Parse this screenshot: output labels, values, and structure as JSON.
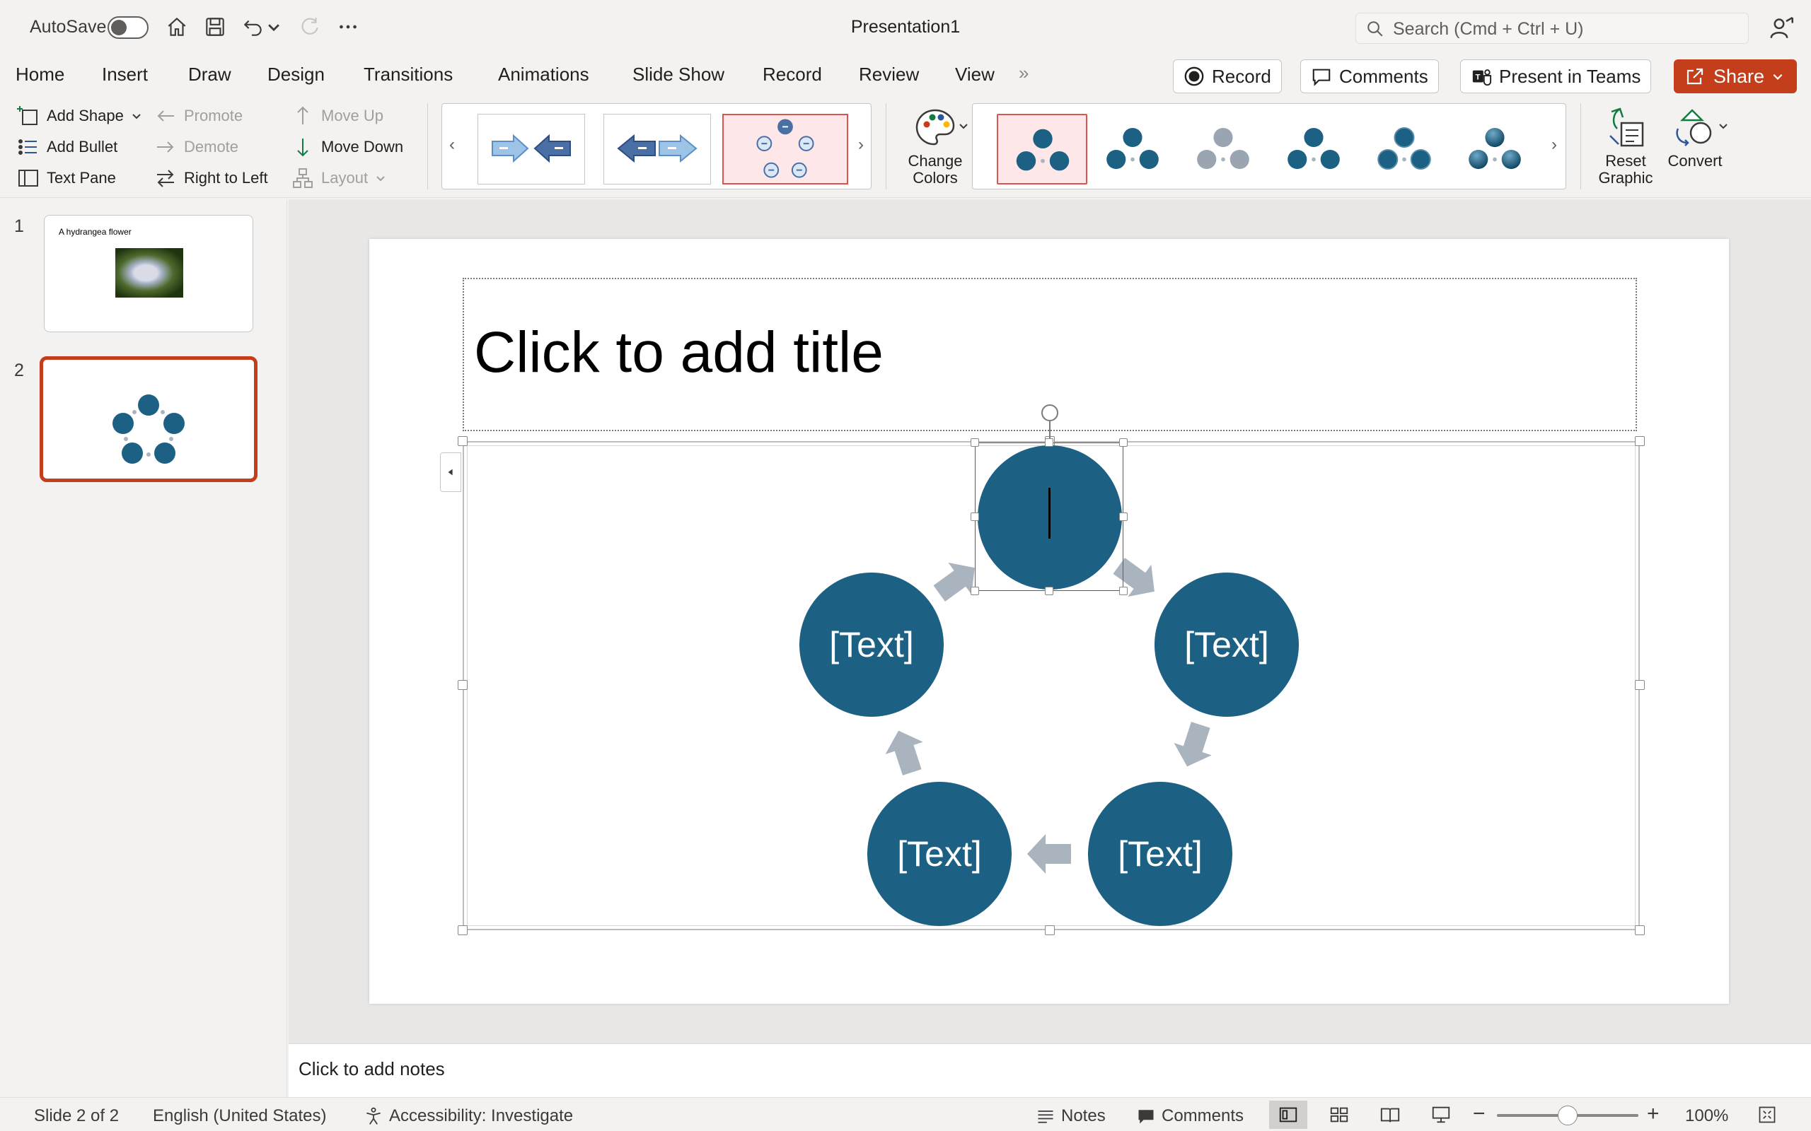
{
  "titlebar": {
    "autosave_label": "AutoSave",
    "doc_title": "Presentation1",
    "search_placeholder": "Search (Cmd + Ctrl + U)"
  },
  "tabs": [
    "Home",
    "Insert",
    "Draw",
    "Design",
    "Transitions",
    "Animations",
    "Slide Show",
    "Record",
    "Review",
    "View"
  ],
  "top_buttons": {
    "record": "Record",
    "comments": "Comments",
    "present_in_teams": "Present in Teams",
    "share": "Share"
  },
  "ribbon": {
    "add_shape": "Add Shape",
    "add_bullet": "Add Bullet",
    "text_pane": "Text Pane",
    "promote": "Promote",
    "demote": "Demote",
    "right_to_left": "Right to Left",
    "move_up": "Move Up",
    "move_down": "Move Down",
    "layout": "Layout",
    "change_colors_line1": "Change",
    "change_colors_line2": "Colors",
    "reset_graphic_line1": "Reset",
    "reset_graphic_line2": "Graphic",
    "convert": "Convert"
  },
  "slides": [
    {
      "number": "1",
      "title": "A hydrangea flower"
    },
    {
      "number": "2"
    }
  ],
  "slide": {
    "title_placeholder": "Click to add title",
    "nodes": [
      "",
      "[Text]",
      "[Text]",
      "[Text]",
      "[Text]"
    ]
  },
  "notes_placeholder": "Click to add notes",
  "statusbar": {
    "slide_info": "Slide 2 of 2",
    "language": "English (United States)",
    "accessibility": "Accessibility: Investigate",
    "notes": "Notes",
    "comments": "Comments",
    "zoom": "100%",
    "zoom_level_percent": 100
  },
  "colors": {
    "accent": "#c43e1c",
    "node": "#1c6184",
    "arrow": "#a9b4bf"
  }
}
